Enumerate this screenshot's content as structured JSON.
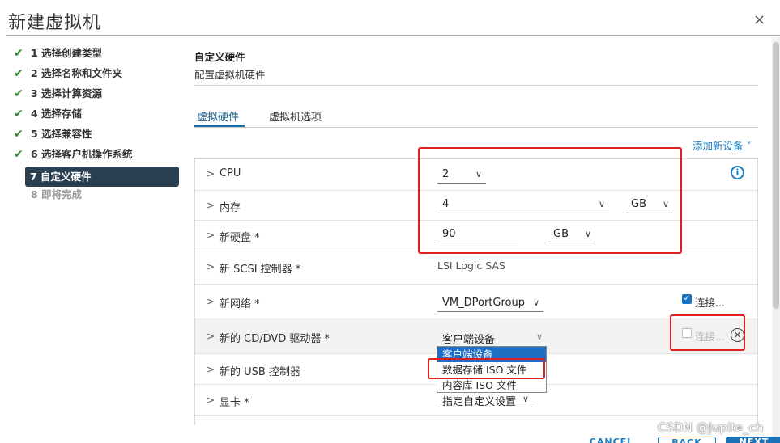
{
  "window": {
    "title": "新建虚拟机",
    "close_label": "×"
  },
  "steps": [
    {
      "label": "1 选择创建类型",
      "status": "done"
    },
    {
      "label": "2 选择名称和文件夹",
      "status": "done"
    },
    {
      "label": "3 选择计算资源",
      "status": "done"
    },
    {
      "label": "4 选择存储",
      "status": "done"
    },
    {
      "label": "5 选择兼容性",
      "status": "done"
    },
    {
      "label": "6 选择客户机操作系统",
      "status": "done"
    },
    {
      "label": "7 自定义硬件",
      "status": "active"
    },
    {
      "label": "8 即将完成",
      "status": "disabled"
    }
  ],
  "section": {
    "title": "自定义硬件",
    "subtitle": "配置虚拟机硬件"
  },
  "tabs": [
    {
      "label": "虚拟硬件",
      "active": true
    },
    {
      "label": "虚拟机选项",
      "active": false
    }
  ],
  "add_device": "添加新设备 ˅",
  "hardware": {
    "cpu": {
      "label": "CPU",
      "value": "2"
    },
    "memory": {
      "label": "内存",
      "value": "4",
      "unit": "GB"
    },
    "disk": {
      "label": "新硬盘 *",
      "value": "90",
      "unit": "GB"
    },
    "scsi": {
      "label": "新 SCSI 控制器 *",
      "value": "LSI Logic SAS"
    },
    "network": {
      "label": "新网络 *",
      "value": "VM_DPortGroup",
      "connect_label": "连接...",
      "connected": true
    },
    "cdrom": {
      "label": "新的 CD/DVD 驱动器 *",
      "value": "客户端设备",
      "connect_label": "连接...",
      "connected": false
    },
    "usb": {
      "label": "新的 USB 控制器"
    },
    "video": {
      "label": "显卡 *",
      "value": "指定自定义设置"
    }
  },
  "cdrom_options": [
    "客户端设备",
    "数据存储 ISO 文件",
    "内容库 ISO 文件"
  ],
  "footer": {
    "cancel": "CANCEL",
    "back": "BACK",
    "next": "NEXT"
  },
  "watermark": "CSDN @Jupite_ch",
  "colors": {
    "accent": "#1a7fc0",
    "active_step_bg": "#2b3f53",
    "highlight": "#e02020",
    "check": "#2e8a2e"
  }
}
